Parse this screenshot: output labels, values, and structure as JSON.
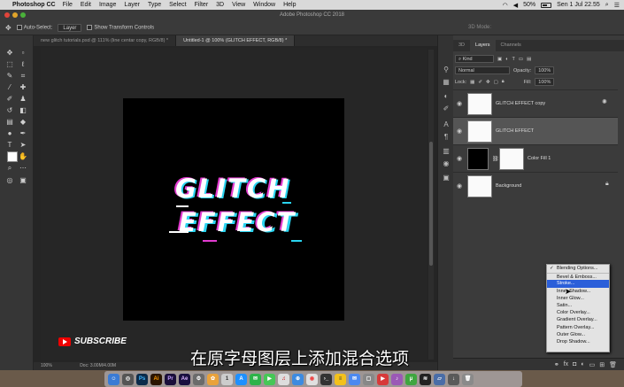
{
  "menubar": {
    "app_name": "Photoshop CC",
    "items": [
      "File",
      "Edit",
      "Image",
      "Layer",
      "Type",
      "Select",
      "Filter",
      "3D",
      "View",
      "Window",
      "Help"
    ],
    "battery": "50%",
    "clock": "Sen 1 Jul  22.55"
  },
  "window_title": "Adobe Photoshop CC 2018",
  "options_bar": {
    "auto_select_label": "Auto-Select:",
    "auto_select_value": "Layer",
    "transform_label": "Show Transform Controls",
    "mode_3d": "3D Mode:"
  },
  "doc_tabs": [
    {
      "label": "new glitch tutorials.psd @ 111% (line centar copy, RGB/8) *"
    },
    {
      "label": "Untitled-1 @ 100% (GLITCH EFFECT, RGB/8) *"
    }
  ],
  "artwork": {
    "line1": "GLITCH",
    "line2": "EFFECT"
  },
  "status_bar": {
    "zoom": "100%",
    "doc_size": "Doc: 3.00M/4.00M"
  },
  "panel": {
    "tabs": [
      "3D",
      "Layers",
      "Channels"
    ],
    "filter_kind": "Kind",
    "blend_mode": "Normal",
    "opacity_label": "Opacity:",
    "opacity_value": "100%",
    "lock_label": "Lock:",
    "fill_label": "Fill:",
    "fill_value": "100%"
  },
  "layers": [
    {
      "name": "GLITCH EFFECT copy"
    },
    {
      "name": "GLITCH EFFECT"
    },
    {
      "name": "Color Fill 1"
    },
    {
      "name": "Background"
    }
  ],
  "context_menu": {
    "items": [
      "Blending Options...",
      "Bevel & Emboss...",
      "Stroke...",
      "Inner Shadow...",
      "Inner Glow...",
      "Satin...",
      "Color Overlay...",
      "Gradient Overlay...",
      "Pattern Overlay...",
      "Outer Glow...",
      "Drop Shadow..."
    ]
  },
  "overlay": {
    "subscribe": "SUBSCRIBE",
    "subtitle": "在原字母图层上添加混合选项"
  },
  "colors": {
    "cyan": "#2ad4f0",
    "magenta": "#e23bd0",
    "highlight": "#2b5fd9"
  }
}
